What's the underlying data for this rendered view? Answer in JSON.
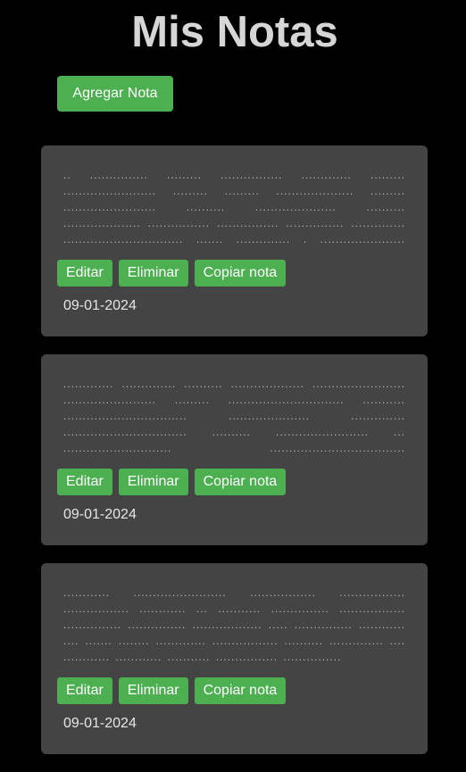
{
  "header": {
    "title": "Mis Notas",
    "add_label": "Agregar Nota"
  },
  "colors": {
    "background": "#000000",
    "title": "#d6d6d6",
    "card": "#444444",
    "button": "#4caf50",
    "button_text": "#ffffff"
  },
  "notes": [
    {
      "text": ".. ............... ......... ................ ............. ......... ........................ ......... ......... .................... ......... ........................ .......... ..................... .......... .................... ................ ................ ............... .............. ............................... ....... .............. . ...................... ................................. ..........",
      "edit_label": "Editar",
      "delete_label": "Eliminar",
      "copy_label": "Copiar nota",
      "date": "09-01-2024"
    },
    {
      "text": "............. .............. .......... ................... ........................ ........................ ......... .............................. ........... ................................ ..................... .............. ................................ .......... ........................ ... ............................ ................................... ................................ ................",
      "edit_label": "Editar",
      "delete_label": "Eliminar",
      "copy_label": "Copiar nota",
      "date": "09-01-2024"
    },
    {
      "text": "............ ........................ ................. ................. ................. ............ ... ........... ............... ................. ............... ............... .................. ..... ............... ............ .... ....... ........ ............. ................. .......... .............. .... ............ ............ ........... ................ ...............",
      "edit_label": "Editar",
      "delete_label": "Eliminar",
      "copy_label": "Copiar nota",
      "date": "09-01-2024"
    }
  ]
}
